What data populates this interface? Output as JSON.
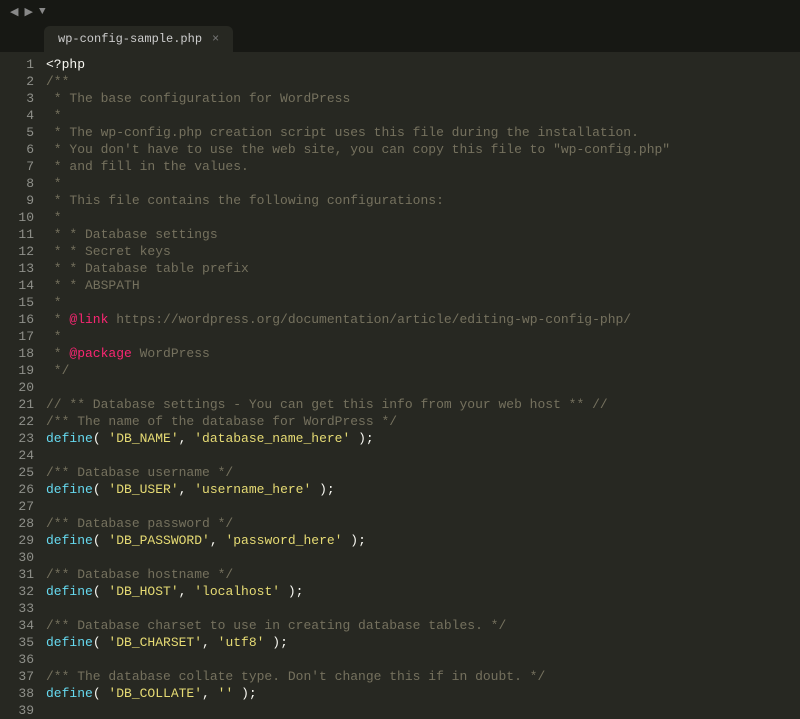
{
  "nav": {
    "back": "◀",
    "forward": "▶",
    "expand": "▼"
  },
  "tab": {
    "title": "wp-config-sample.php",
    "close": "×"
  },
  "code": {
    "lines": [
      [
        {
          "t": "default",
          "v": "<?php"
        }
      ],
      [
        {
          "t": "comment",
          "v": "/**"
        }
      ],
      [
        {
          "t": "comment",
          "v": " * The base configuration for WordPress"
        }
      ],
      [
        {
          "t": "comment",
          "v": " *"
        }
      ],
      [
        {
          "t": "comment",
          "v": " * The wp-config.php creation script uses this file during the installation."
        }
      ],
      [
        {
          "t": "comment",
          "v": " * You don't have to use the web site, you can copy this file to \"wp-config.php\""
        }
      ],
      [
        {
          "t": "comment",
          "v": " * and fill in the values."
        }
      ],
      [
        {
          "t": "comment",
          "v": " *"
        }
      ],
      [
        {
          "t": "comment",
          "v": " * This file contains the following configurations:"
        }
      ],
      [
        {
          "t": "comment",
          "v": " *"
        }
      ],
      [
        {
          "t": "comment",
          "v": " * * Database settings"
        }
      ],
      [
        {
          "t": "comment",
          "v": " * * Secret keys"
        }
      ],
      [
        {
          "t": "comment",
          "v": " * * Database table prefix"
        }
      ],
      [
        {
          "t": "comment",
          "v": " * * ABSPATH"
        }
      ],
      [
        {
          "t": "comment",
          "v": " *"
        }
      ],
      [
        {
          "t": "comment",
          "v": " * "
        },
        {
          "t": "doctag",
          "v": "@link"
        },
        {
          "t": "comment",
          "v": " https://wordpress.org/documentation/article/editing-wp-config-php/"
        }
      ],
      [
        {
          "t": "comment",
          "v": " *"
        }
      ],
      [
        {
          "t": "comment",
          "v": " * "
        },
        {
          "t": "doctag",
          "v": "@package"
        },
        {
          "t": "comment",
          "v": " WordPress"
        }
      ],
      [
        {
          "t": "comment",
          "v": " */"
        }
      ],
      [
        {
          "t": "default",
          "v": ""
        }
      ],
      [
        {
          "t": "comment",
          "v": "// ** Database settings - You can get this info from your web host ** //"
        }
      ],
      [
        {
          "t": "comment",
          "v": "/** The name of the database for WordPress */"
        }
      ],
      [
        {
          "t": "keyword",
          "v": "define"
        },
        {
          "t": "punct",
          "v": "( "
        },
        {
          "t": "string",
          "v": "'DB_NAME'"
        },
        {
          "t": "punct",
          "v": ", "
        },
        {
          "t": "string",
          "v": "'database_name_here'"
        },
        {
          "t": "punct",
          "v": " );"
        }
      ],
      [
        {
          "t": "default",
          "v": ""
        }
      ],
      [
        {
          "t": "comment",
          "v": "/** Database username */"
        }
      ],
      [
        {
          "t": "keyword",
          "v": "define"
        },
        {
          "t": "punct",
          "v": "( "
        },
        {
          "t": "string",
          "v": "'DB_USER'"
        },
        {
          "t": "punct",
          "v": ", "
        },
        {
          "t": "string",
          "v": "'username_here'"
        },
        {
          "t": "punct",
          "v": " );"
        }
      ],
      [
        {
          "t": "default",
          "v": ""
        }
      ],
      [
        {
          "t": "comment",
          "v": "/** Database password */"
        }
      ],
      [
        {
          "t": "keyword",
          "v": "define"
        },
        {
          "t": "punct",
          "v": "( "
        },
        {
          "t": "string",
          "v": "'DB_PASSWORD'"
        },
        {
          "t": "punct",
          "v": ", "
        },
        {
          "t": "string",
          "v": "'password_here'"
        },
        {
          "t": "punct",
          "v": " );"
        }
      ],
      [
        {
          "t": "default",
          "v": ""
        }
      ],
      [
        {
          "t": "comment",
          "v": "/** Database hostname */"
        }
      ],
      [
        {
          "t": "keyword",
          "v": "define"
        },
        {
          "t": "punct",
          "v": "( "
        },
        {
          "t": "string",
          "v": "'DB_HOST'"
        },
        {
          "t": "punct",
          "v": ", "
        },
        {
          "t": "string",
          "v": "'localhost'"
        },
        {
          "t": "punct",
          "v": " );"
        }
      ],
      [
        {
          "t": "default",
          "v": ""
        }
      ],
      [
        {
          "t": "comment",
          "v": "/** Database charset to use in creating database tables. */"
        }
      ],
      [
        {
          "t": "keyword",
          "v": "define"
        },
        {
          "t": "punct",
          "v": "( "
        },
        {
          "t": "string",
          "v": "'DB_CHARSET'"
        },
        {
          "t": "punct",
          "v": ", "
        },
        {
          "t": "string",
          "v": "'utf8'"
        },
        {
          "t": "punct",
          "v": " );"
        }
      ],
      [
        {
          "t": "default",
          "v": ""
        }
      ],
      [
        {
          "t": "comment",
          "v": "/** The database collate type. Don't change this if in doubt. */"
        }
      ],
      [
        {
          "t": "keyword",
          "v": "define"
        },
        {
          "t": "punct",
          "v": "( "
        },
        {
          "t": "string",
          "v": "'DB_COLLATE'"
        },
        {
          "t": "punct",
          "v": ", "
        },
        {
          "t": "string",
          "v": "''"
        },
        {
          "t": "punct",
          "v": " );"
        }
      ],
      [
        {
          "t": "default",
          "v": ""
        }
      ]
    ]
  }
}
